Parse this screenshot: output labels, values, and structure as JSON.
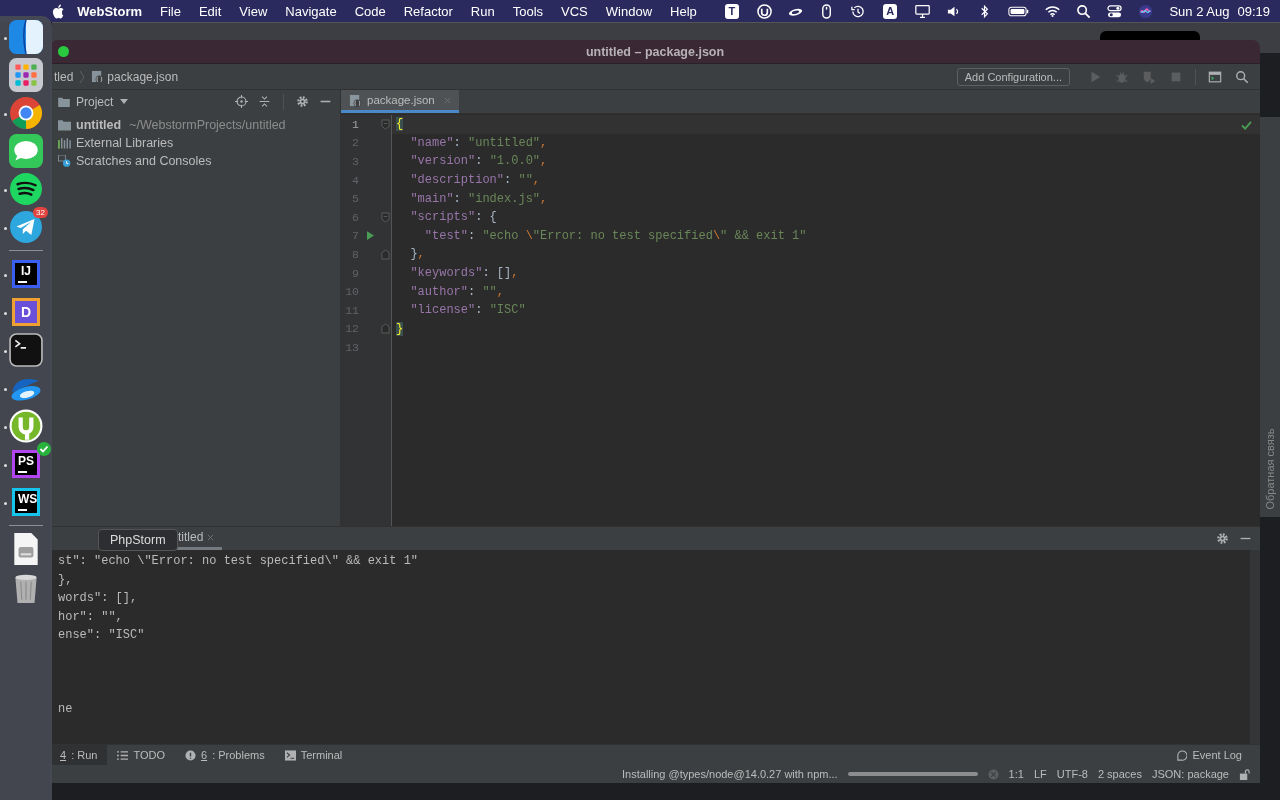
{
  "menu_bar": {
    "app_name": "WebStorm",
    "menus": [
      "File",
      "Edit",
      "View",
      "Navigate",
      "Code",
      "Refactor",
      "Run",
      "Tools",
      "VCS",
      "Window",
      "Help"
    ],
    "status_items": [
      {
        "kind": "letter",
        "text": "T"
      },
      {
        "kind": "torrent"
      },
      {
        "kind": "saucer"
      },
      {
        "kind": "mouse"
      },
      {
        "kind": "history"
      },
      {
        "kind": "letter",
        "text": "A"
      },
      {
        "kind": "display"
      },
      {
        "kind": "volume"
      },
      {
        "kind": "bluetooth"
      },
      {
        "kind": "battery"
      },
      {
        "kind": "wifi"
      },
      {
        "kind": "search"
      },
      {
        "kind": "toggles"
      },
      {
        "kind": "siri"
      }
    ],
    "date": "Sun 2 Aug",
    "time": "09:19"
  },
  "background_window": {
    "side_label": "Обратная связь"
  },
  "window": {
    "title": "untitled – package.json"
  },
  "navigation_bar": {
    "breadcrumbs": [
      {
        "label": "tled",
        "kind": "folder"
      },
      {
        "label": "package.json",
        "kind": "json"
      }
    ],
    "config_button": "Add Configuration...",
    "actions": [
      {
        "kind": "run",
        "disabled": true
      },
      {
        "kind": "debug",
        "disabled": true
      },
      {
        "kind": "coverage",
        "disabled": true
      },
      {
        "kind": "stop",
        "disabled": true
      },
      {
        "kind": "terminal",
        "disabled": false
      },
      {
        "kind": "search",
        "disabled": false
      }
    ]
  },
  "project_panel": {
    "title": "Project",
    "items": [
      {
        "kind": "folder",
        "name": "untitled",
        "path": "~/WebstormProjects/untitled"
      },
      {
        "kind": "libraries",
        "name": "External Libraries"
      },
      {
        "kind": "scratches",
        "name": "Scratches and Consoles"
      }
    ]
  },
  "editor": {
    "tabs": [
      {
        "label": "package.json",
        "selected": true
      }
    ],
    "lines": [
      {
        "number": "1",
        "current": true,
        "runnable": false,
        "fold_start": true,
        "fold_end": false,
        "tokens": [
          {
            "kind": "brace_match",
            "text": "{"
          }
        ]
      },
      {
        "number": "2",
        "current": false,
        "runnable": false,
        "fold_start": false,
        "fold_end": false,
        "tokens": [
          {
            "kind": "key",
            "text": "  \"name\""
          },
          {
            "kind": "plain",
            "text": ": "
          },
          {
            "kind": "string",
            "text": "\"untitled\""
          },
          {
            "kind": "punct",
            "text": ","
          }
        ]
      },
      {
        "number": "3",
        "current": false,
        "runnable": false,
        "fold_start": false,
        "fold_end": false,
        "tokens": [
          {
            "kind": "key",
            "text": "  \"version\""
          },
          {
            "kind": "plain",
            "text": ": "
          },
          {
            "kind": "string",
            "text": "\"1.0.0\""
          },
          {
            "kind": "punct",
            "text": ","
          }
        ]
      },
      {
        "number": "4",
        "current": false,
        "runnable": false,
        "fold_start": false,
        "fold_end": false,
        "tokens": [
          {
            "kind": "key",
            "text": "  \"description\""
          },
          {
            "kind": "plain",
            "text": ": "
          },
          {
            "kind": "string",
            "text": "\"\""
          },
          {
            "kind": "punct",
            "text": ","
          }
        ]
      },
      {
        "number": "5",
        "current": false,
        "runnable": false,
        "fold_start": false,
        "fold_end": false,
        "tokens": [
          {
            "kind": "key",
            "text": "  \"main\""
          },
          {
            "kind": "plain",
            "text": ": "
          },
          {
            "kind": "string",
            "text": "\"index.js\""
          },
          {
            "kind": "punct",
            "text": ","
          }
        ]
      },
      {
        "number": "6",
        "current": false,
        "runnable": false,
        "fold_start": true,
        "fold_end": false,
        "tokens": [
          {
            "kind": "key",
            "text": "  \"scripts\""
          },
          {
            "kind": "plain",
            "text": ": {"
          }
        ]
      },
      {
        "number": "7",
        "current": false,
        "runnable": true,
        "fold_start": false,
        "fold_end": false,
        "tokens": [
          {
            "kind": "key",
            "text": "    \"test\""
          },
          {
            "kind": "plain",
            "text": ": "
          },
          {
            "kind": "string",
            "text": "\"echo "
          },
          {
            "kind": "escape",
            "text": "\\"
          },
          {
            "kind": "string",
            "text": "\"Error: no test specified"
          },
          {
            "kind": "escape",
            "text": "\\"
          },
          {
            "kind": "string",
            "text": "\" && exit 1\""
          }
        ]
      },
      {
        "number": "8",
        "current": false,
        "runnable": false,
        "fold_start": false,
        "fold_end": true,
        "tokens": [
          {
            "kind": "plain",
            "text": "  }"
          },
          {
            "kind": "punct",
            "text": ","
          }
        ]
      },
      {
        "number": "9",
        "current": false,
        "runnable": false,
        "fold_start": false,
        "fold_end": false,
        "tokens": [
          {
            "kind": "key",
            "text": "  \"keywords\""
          },
          {
            "kind": "plain",
            "text": ": []"
          },
          {
            "kind": "punct",
            "text": ","
          }
        ]
      },
      {
        "number": "10",
        "current": false,
        "runnable": false,
        "fold_start": false,
        "fold_end": false,
        "tokens": [
          {
            "kind": "key",
            "text": "  \"author\""
          },
          {
            "kind": "plain",
            "text": ": "
          },
          {
            "kind": "string",
            "text": "\"\""
          },
          {
            "kind": "punct",
            "text": ","
          }
        ]
      },
      {
        "number": "11",
        "current": false,
        "runnable": false,
        "fold_start": false,
        "fold_end": false,
        "tokens": [
          {
            "kind": "key",
            "text": "  \"license\""
          },
          {
            "kind": "plain",
            "text": ": "
          },
          {
            "kind": "string",
            "text": "\"ISC\""
          }
        ]
      },
      {
        "number": "12",
        "current": false,
        "runnable": false,
        "fold_start": false,
        "fold_end": true,
        "tokens": [
          {
            "kind": "brace_match",
            "text": "}"
          }
        ]
      },
      {
        "number": "13",
        "current": false,
        "runnable": false,
        "fold_start": false,
        "fold_end": false
      }
    ]
  },
  "run_panel": {
    "tabs": [
      {
        "label": "titled",
        "selected": true
      }
    ],
    "console_lines": [
      "st\": \"echo \\\"Error: no test specified\\\" && exit 1\"",
      "},",
      "words\": [],",
      "hor\": \"\",",
      "ense\": \"ISC\""
    ],
    "footer_text": "ne"
  },
  "tool_windows": [
    {
      "kind": "run",
      "mnemonic": "4",
      "label": ": Run",
      "selected": true
    },
    {
      "kind": "todo",
      "label": "TODO",
      "selected": false
    },
    {
      "kind": "problems",
      "mnemonic": "6",
      "label": ": Problems",
      "selected": false
    },
    {
      "kind": "terminal",
      "label": "Terminal",
      "selected": false
    }
  ],
  "event_log": "Event Log",
  "status_bar": {
    "task": "Installing @types/node@14.0.27 with npm...",
    "progress": {
      "level": 1
    },
    "items": [
      "1:1",
      "LF",
      "UTF-8",
      "2 spaces",
      "JSON: package"
    ]
  },
  "dock": {
    "tooltip": "PhpStorm",
    "items": [
      {
        "kind": "finder",
        "running": true
      },
      {
        "kind": "launchpad",
        "running": false
      },
      {
        "kind": "chrome",
        "running": true
      },
      {
        "kind": "messages",
        "running": false
      },
      {
        "kind": "spotify",
        "running": true
      },
      {
        "kind": "telegram",
        "running": true,
        "badge": "32"
      },
      {
        "kind": "divider"
      },
      {
        "kind": "jetbrains",
        "label": "IJ",
        "running": true
      },
      {
        "kind": "dapp",
        "label": "D",
        "running": true
      },
      {
        "kind": "terminal",
        "running": true
      },
      {
        "kind": "saucer",
        "running": true
      },
      {
        "kind": "torrent",
        "running": true
      },
      {
        "kind": "phpstorm",
        "label": "PS",
        "running": true
      },
      {
        "kind": "webstorm",
        "label": "WS",
        "running": true
      },
      {
        "kind": "divider"
      },
      {
        "kind": "diskimage",
        "running": false
      },
      {
        "kind": "trash",
        "running": false
      }
    ]
  }
}
